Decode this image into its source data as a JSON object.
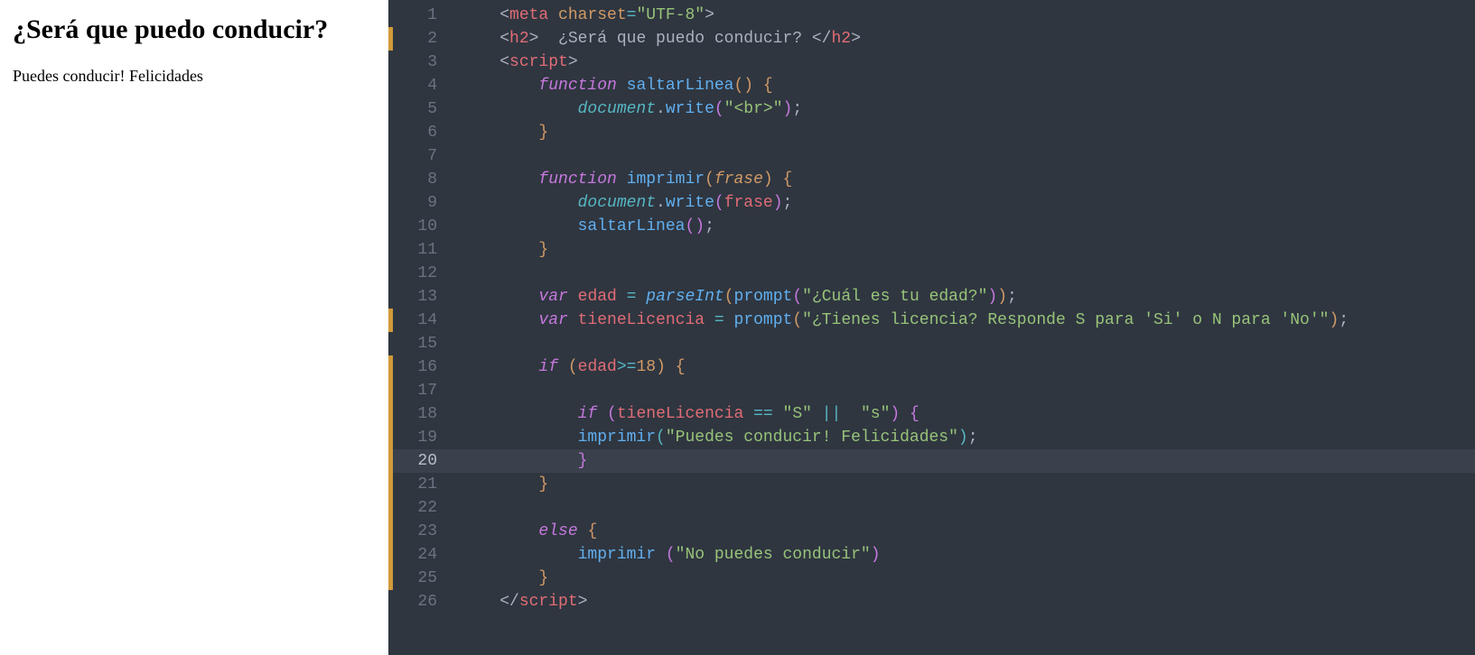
{
  "preview": {
    "heading": "¿Será que puedo conducir?",
    "body": "Puedes conducir! Felicidades"
  },
  "editor": {
    "highlighted_line": 20,
    "modified_lines": [
      2,
      14,
      16,
      17,
      18,
      19,
      20,
      21,
      22,
      23,
      24,
      25
    ],
    "lines": [
      {
        "n": 1,
        "tokens": [
          [
            "p",
            "    <"
          ],
          [
            "tag",
            "meta"
          ],
          [
            "p",
            " "
          ],
          [
            "attr",
            "charset"
          ],
          [
            "op",
            "="
          ],
          [
            "str",
            "\"UTF-8\""
          ],
          [
            "p",
            ">"
          ]
        ]
      },
      {
        "n": 2,
        "tokens": [
          [
            "p",
            "    <"
          ],
          [
            "tag",
            "h2"
          ],
          [
            "p",
            ">  ¿Será que puedo conducir? </"
          ],
          [
            "tag",
            "h2"
          ],
          [
            "p",
            ">"
          ]
        ]
      },
      {
        "n": 3,
        "tokens": [
          [
            "p",
            "    <"
          ],
          [
            "tag",
            "script"
          ],
          [
            "p",
            ">"
          ]
        ]
      },
      {
        "n": 4,
        "tokens": [
          [
            "p",
            "        "
          ],
          [
            "fk",
            "function"
          ],
          [
            "p",
            " "
          ],
          [
            "fn",
            "saltarLinea"
          ],
          [
            "br",
            "()"
          ],
          [
            "p",
            " "
          ],
          [
            "br",
            "{"
          ]
        ]
      },
      {
        "n": 5,
        "tokens": [
          [
            "p",
            "            "
          ],
          [
            "obj",
            "document"
          ],
          [
            "p",
            "."
          ],
          [
            "fn",
            "write"
          ],
          [
            "brP",
            "("
          ],
          [
            "str",
            "\"<br>\""
          ],
          [
            "brP",
            ")"
          ],
          [
            "p",
            ";"
          ]
        ]
      },
      {
        "n": 6,
        "tokens": [
          [
            "p",
            "        "
          ],
          [
            "br",
            "}"
          ]
        ]
      },
      {
        "n": 7,
        "tokens": [
          [
            "p",
            ""
          ]
        ]
      },
      {
        "n": 8,
        "tokens": [
          [
            "p",
            "        "
          ],
          [
            "fk",
            "function"
          ],
          [
            "p",
            " "
          ],
          [
            "fn",
            "imprimir"
          ],
          [
            "br",
            "("
          ],
          [
            "prm",
            "frase"
          ],
          [
            "br",
            ")"
          ],
          [
            "p",
            " "
          ],
          [
            "br",
            "{"
          ]
        ]
      },
      {
        "n": 9,
        "tokens": [
          [
            "p",
            "            "
          ],
          [
            "obj",
            "document"
          ],
          [
            "p",
            "."
          ],
          [
            "fn",
            "write"
          ],
          [
            "brP",
            "("
          ],
          [
            "id",
            "frase"
          ],
          [
            "brP",
            ")"
          ],
          [
            "p",
            ";"
          ]
        ]
      },
      {
        "n": 10,
        "tokens": [
          [
            "p",
            "            "
          ],
          [
            "fn",
            "saltarLinea"
          ],
          [
            "brP",
            "()"
          ],
          [
            "p",
            ";"
          ]
        ]
      },
      {
        "n": 11,
        "tokens": [
          [
            "p",
            "        "
          ],
          [
            "br",
            "}"
          ]
        ]
      },
      {
        "n": 12,
        "tokens": [
          [
            "p",
            ""
          ]
        ]
      },
      {
        "n": 13,
        "tokens": [
          [
            "p",
            "        "
          ],
          [
            "kw",
            "var"
          ],
          [
            "p",
            " "
          ],
          [
            "id",
            "edad"
          ],
          [
            "p",
            " "
          ],
          [
            "op",
            "="
          ],
          [
            "p",
            " "
          ],
          [
            "fnIt",
            "parseInt"
          ],
          [
            "br",
            "("
          ],
          [
            "fn",
            "prompt"
          ],
          [
            "brP",
            "("
          ],
          [
            "str",
            "\"¿Cuál es tu edad?\""
          ],
          [
            "brP",
            ")"
          ],
          [
            "br",
            ")"
          ],
          [
            "p",
            ";"
          ]
        ]
      },
      {
        "n": 14,
        "tokens": [
          [
            "p",
            "        "
          ],
          [
            "kw",
            "var"
          ],
          [
            "p",
            " "
          ],
          [
            "id",
            "tieneLicencia"
          ],
          [
            "p",
            " "
          ],
          [
            "op",
            "="
          ],
          [
            "p",
            " "
          ],
          [
            "fn",
            "prompt"
          ],
          [
            "br",
            "("
          ],
          [
            "str",
            "\"¿Tienes licencia? Responde S para 'Si' o N para 'No'\""
          ],
          [
            "br",
            ")"
          ],
          [
            "p",
            ";"
          ]
        ]
      },
      {
        "n": 15,
        "tokens": [
          [
            "p",
            ""
          ]
        ]
      },
      {
        "n": 16,
        "tokens": [
          [
            "p",
            "        "
          ],
          [
            "kw",
            "if"
          ],
          [
            "p",
            " "
          ],
          [
            "br",
            "("
          ],
          [
            "id",
            "edad"
          ],
          [
            "op",
            ">="
          ],
          [
            "num",
            "18"
          ],
          [
            "br",
            ")"
          ],
          [
            "p",
            " "
          ],
          [
            "br",
            "{"
          ]
        ]
      },
      {
        "n": 17,
        "tokens": [
          [
            "p",
            ""
          ]
        ]
      },
      {
        "n": 18,
        "tokens": [
          [
            "p",
            "            "
          ],
          [
            "kw",
            "if"
          ],
          [
            "p",
            " "
          ],
          [
            "brP",
            "("
          ],
          [
            "id",
            "tieneLicencia"
          ],
          [
            "p",
            " "
          ],
          [
            "op",
            "=="
          ],
          [
            "p",
            " "
          ],
          [
            "str",
            "\"S\""
          ],
          [
            "p",
            " "
          ],
          [
            "op",
            "||"
          ],
          [
            "p",
            "  "
          ],
          [
            "str",
            "\"s\""
          ],
          [
            "brP",
            ")"
          ],
          [
            "p",
            " "
          ],
          [
            "brP",
            "{"
          ]
        ]
      },
      {
        "n": 19,
        "tokens": [
          [
            "p",
            "            "
          ],
          [
            "fn",
            "imprimir"
          ],
          [
            "brB",
            "("
          ],
          [
            "str",
            "\"Puedes conducir! Felicidades\""
          ],
          [
            "brB",
            ")"
          ],
          [
            "p",
            ";"
          ]
        ]
      },
      {
        "n": 20,
        "tokens": [
          [
            "p",
            "            "
          ],
          [
            "brP",
            "}"
          ]
        ]
      },
      {
        "n": 21,
        "tokens": [
          [
            "p",
            "        "
          ],
          [
            "br",
            "}"
          ]
        ]
      },
      {
        "n": 22,
        "tokens": [
          [
            "p",
            ""
          ]
        ]
      },
      {
        "n": 23,
        "tokens": [
          [
            "p",
            "        "
          ],
          [
            "kw",
            "else"
          ],
          [
            "p",
            " "
          ],
          [
            "br",
            "{"
          ]
        ]
      },
      {
        "n": 24,
        "tokens": [
          [
            "p",
            "            "
          ],
          [
            "fn",
            "imprimir"
          ],
          [
            "p",
            " "
          ],
          [
            "brP",
            "("
          ],
          [
            "str",
            "\"No puedes conducir\""
          ],
          [
            "brP",
            ")"
          ]
        ]
      },
      {
        "n": 25,
        "tokens": [
          [
            "p",
            "        "
          ],
          [
            "br",
            "}"
          ]
        ]
      },
      {
        "n": 26,
        "tokens": [
          [
            "p",
            "    </"
          ],
          [
            "tag",
            "script"
          ],
          [
            "p",
            ">"
          ]
        ]
      }
    ]
  }
}
